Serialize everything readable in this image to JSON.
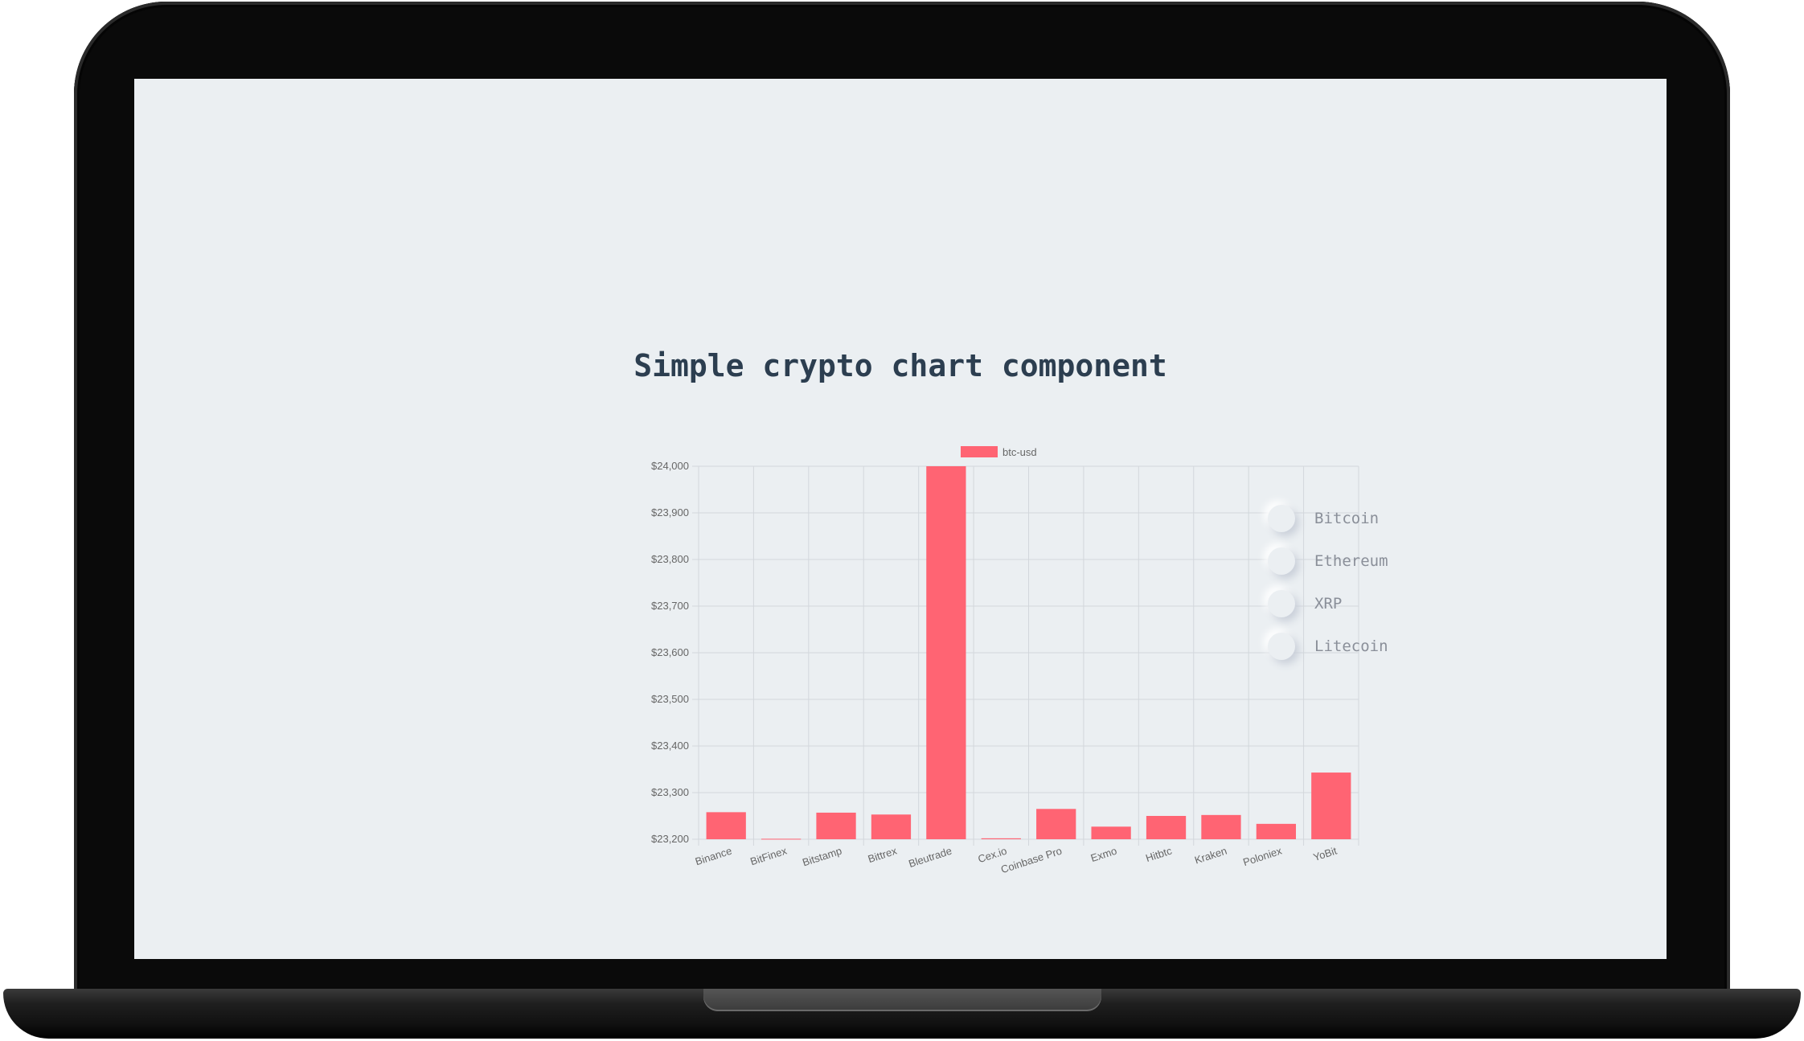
{
  "page": {
    "title": "Simple crypto chart component"
  },
  "coins": [
    {
      "label": "Bitcoin"
    },
    {
      "label": "Ethereum"
    },
    {
      "label": "XRP"
    },
    {
      "label": "Litecoin"
    }
  ],
  "colors": {
    "bar": "#ff6473",
    "screen_background": "#ebeff2",
    "title": "#2c3e50"
  },
  "chart_data": {
    "type": "bar",
    "legend": "top",
    "grid": true,
    "series": [
      {
        "name": "btc-usd",
        "values": [
          23258,
          23201,
          23257,
          23253,
          24000,
          23202,
          23265,
          23227,
          23250,
          23252,
          23233,
          23343
        ]
      }
    ],
    "categories": [
      "Binance",
      "BitFinex",
      "Bitstamp",
      "Bittrex",
      "Bleutrade",
      "Cex.io",
      "Coinbase Pro",
      "Exmo",
      "Hitbtc",
      "Kraken",
      "Poloniex",
      "YoBit"
    ],
    "yticks": [
      "$23,200",
      "$23,300",
      "$23,400",
      "$23,500",
      "$23,600",
      "$23,700",
      "$23,800",
      "$23,900",
      "$24,000"
    ],
    "ylim": [
      23200,
      24000
    ]
  }
}
